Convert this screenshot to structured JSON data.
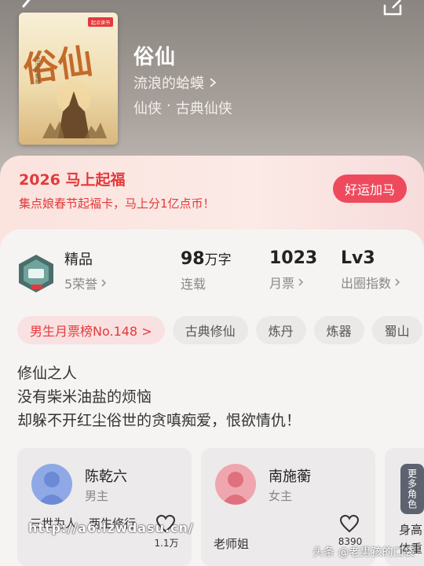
{
  "book": {
    "title": "俗仙",
    "author": "流浪的蛤蟆",
    "genre": "仙侠",
    "subgenre": "古典仙侠",
    "separator": "·",
    "cover_title": "俗仙",
    "cover_brand": "起点读书",
    "cover_author": "流浪的蛤蟆"
  },
  "promo": {
    "title": "2026 马上起福",
    "subtitle": "集点娘春节起福卡，马上分1亿点币！",
    "button": "好运加马"
  },
  "stats": {
    "quality_label": "精品",
    "honors": "5荣誉",
    "words_value": "98",
    "words_unit": "万字",
    "words_label": "连载",
    "monthly_votes": "1023",
    "monthly_votes_label": "月票",
    "level": "Lv3",
    "level_label": "出圈指数"
  },
  "tags": [
    "男生月票榜No.148 >",
    "古典修仙",
    "炼丹",
    "炼器",
    "蜀山"
  ],
  "intro": [
    "修仙之人",
    "没有柴米油盐的烦恼",
    "却躲不开红尘俗世的贪嗔痴爱，恨欲情仇！"
  ],
  "characters": [
    {
      "name": "陈乾六",
      "role": "男主",
      "desc": "三世为人，两生修行",
      "likes": "1.1万"
    },
    {
      "name": "南施蘅",
      "role": "女主",
      "desc": "老师姐",
      "likes": "8390"
    }
  ],
  "more": {
    "label": "更多角色",
    "desc": "身高体重"
  },
  "watermark": {
    "url": "http://a6.lzwdasu.cn/",
    "source": "头条 @老男孩的口袋"
  },
  "colors": {
    "accent": "#e4393c",
    "promo_button": "#ee4a5e"
  }
}
